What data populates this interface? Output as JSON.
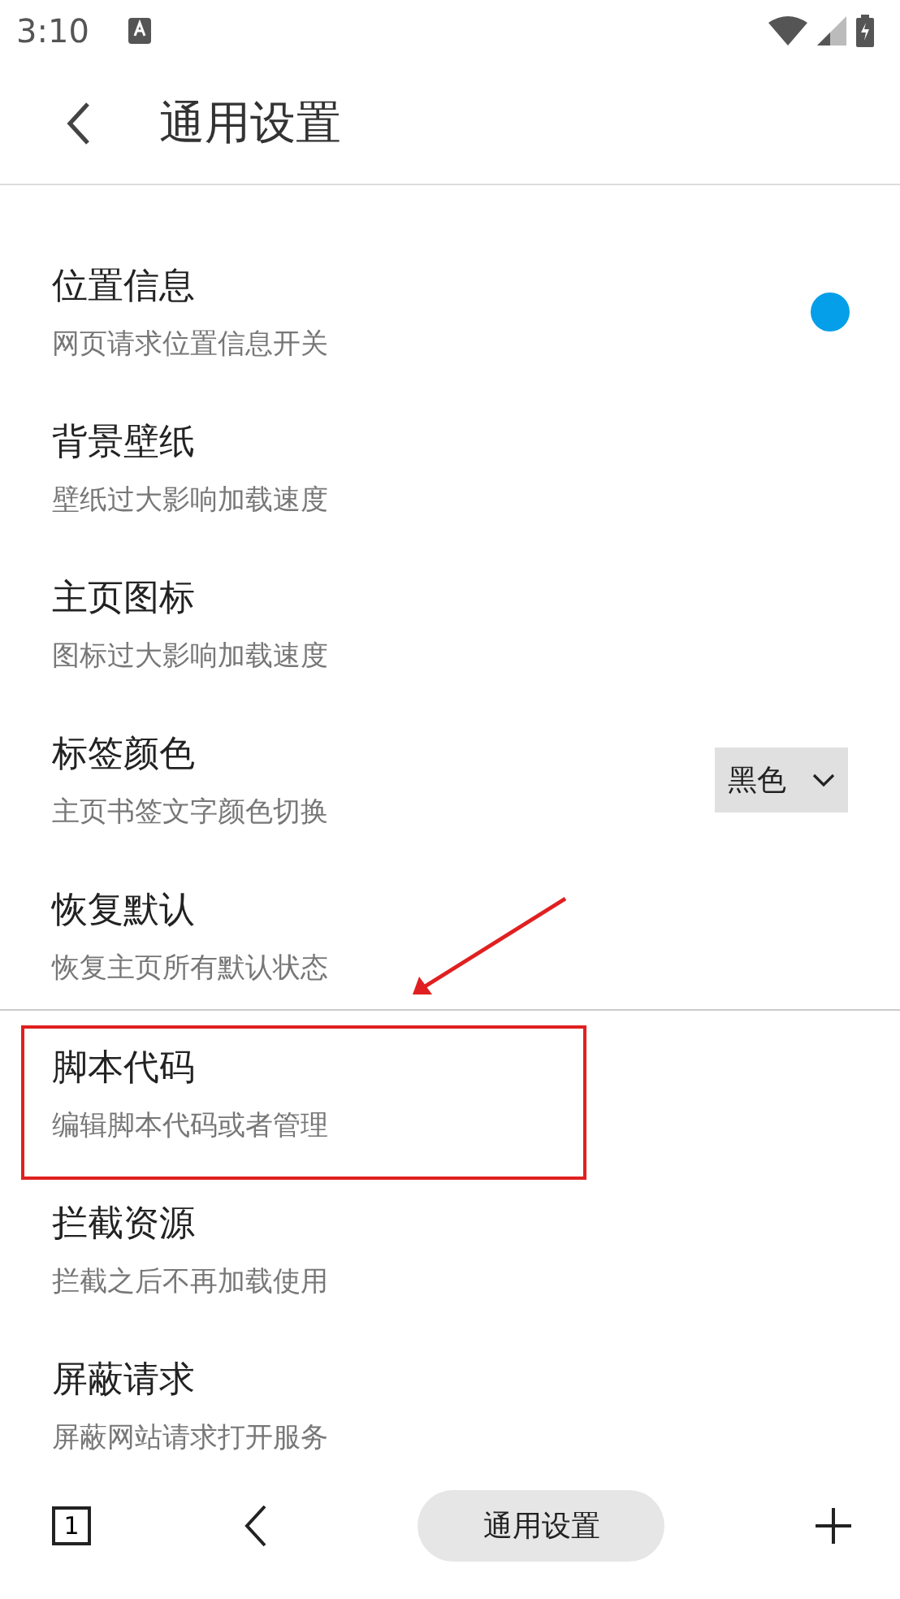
{
  "status_bar": {
    "time": "3:10"
  },
  "header": {
    "title": "通用设置"
  },
  "settings": [
    {
      "kind": "toggle",
      "title": "位置信息",
      "subtitle": "网页请求位置信息开关",
      "on": true
    },
    {
      "kind": "plain",
      "title": "背景壁纸",
      "subtitle": "壁纸过大影响加载速度"
    },
    {
      "kind": "plain",
      "title": "主页图标",
      "subtitle": "图标过大影响加载速度"
    },
    {
      "kind": "select",
      "title": "标签颜色",
      "subtitle": "主页书签文字颜色切换",
      "value": "黑色"
    },
    {
      "kind": "plain",
      "title": "恢复默认",
      "subtitle": "恢复主页所有默认状态",
      "divider_after": true
    },
    {
      "kind": "plain",
      "title": "脚本代码",
      "subtitle": "编辑脚本代码或者管理",
      "highlighted": true
    },
    {
      "kind": "plain",
      "title": "拦截资源",
      "subtitle": "拦截之后不再加载使用"
    },
    {
      "kind": "plain",
      "title": "屏蔽请求",
      "subtitle": "屏蔽网站请求打开服务"
    }
  ],
  "bottom_bar": {
    "tab_count": "1",
    "page_title": "通用设置"
  }
}
